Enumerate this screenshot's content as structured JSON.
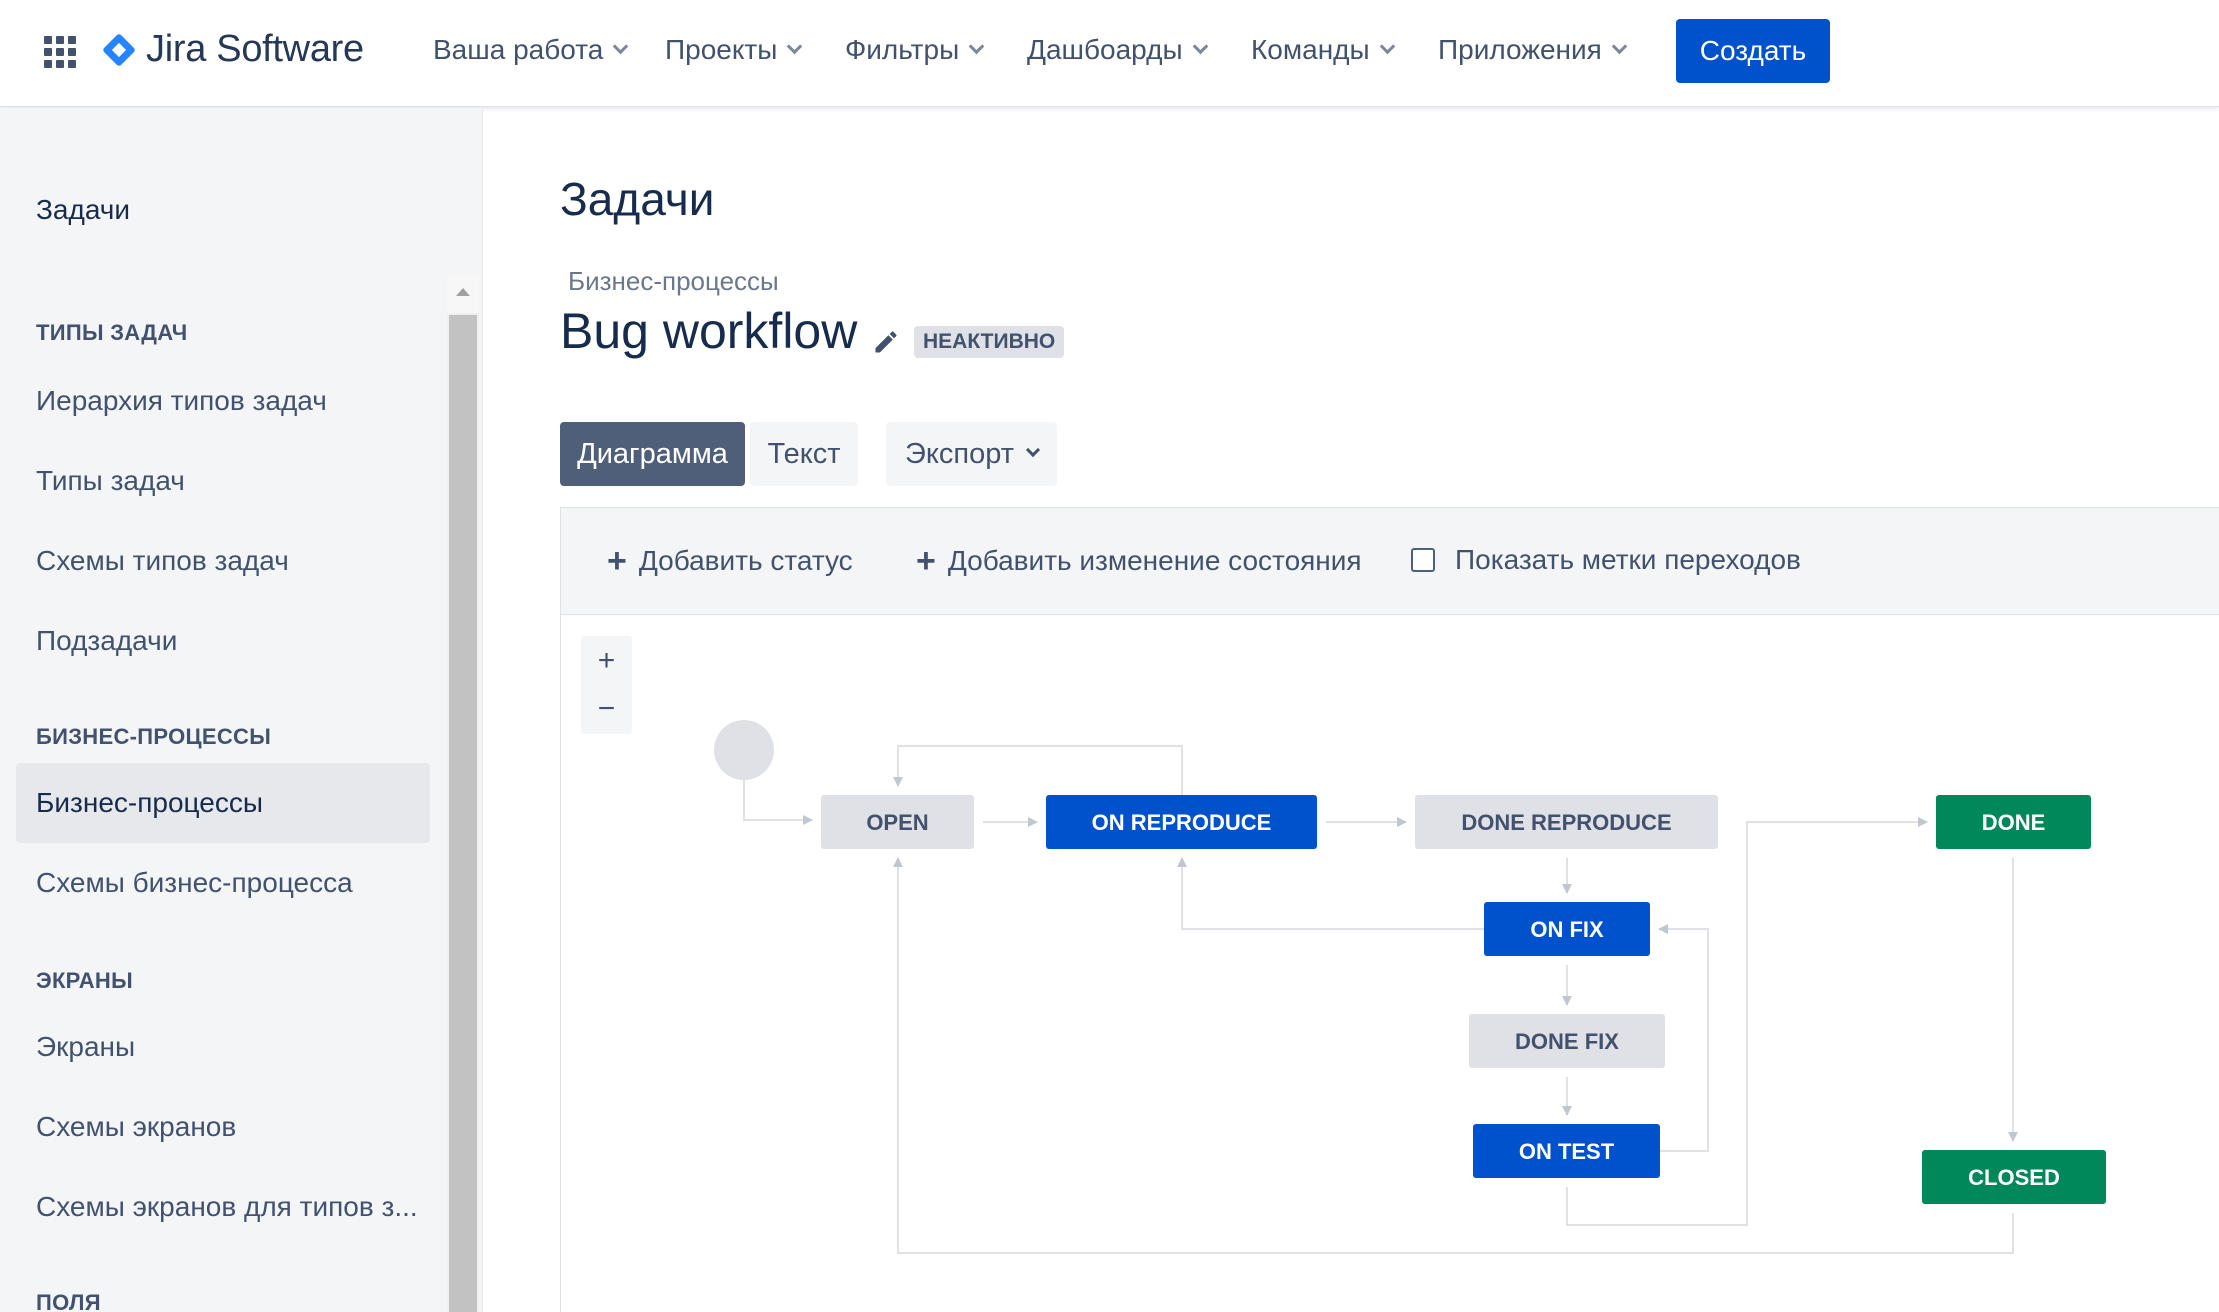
{
  "header": {
    "logo_text": "Jira Software",
    "nav": [
      "Ваша работа",
      "Проекты",
      "Фильтры",
      "Дашбоарды",
      "Команды",
      "Приложения"
    ],
    "create_label": "Создать"
  },
  "sidebar": {
    "title": "Задачи",
    "sections": [
      {
        "heading": "ТИПЫ ЗАДАЧ",
        "items": [
          "Иерархия типов задач",
          "Типы задач",
          "Схемы типов задач",
          "Подзадачи"
        ]
      },
      {
        "heading": "БИЗНЕС-ПРОЦЕССЫ",
        "items": [
          "Бизнес-процессы",
          "Схемы бизнес-процесса"
        ]
      },
      {
        "heading": "ЭКРАНЫ",
        "items": [
          "Экраны",
          "Схемы экранов",
          "Схемы экранов для типов з..."
        ]
      },
      {
        "heading": "ПОЛЯ",
        "items": []
      }
    ],
    "active_item": "Бизнес-процессы"
  },
  "main": {
    "page_title": "Задачи",
    "breadcrumb": "Бизнес-процессы",
    "workflow_name": "Bug workflow",
    "status_badge": "НЕАКТИВНО",
    "tabs": {
      "diagram": "Диаграмма",
      "text": "Текст",
      "export": "Экспорт"
    },
    "active_tab": "Диаграмма",
    "toolbar": {
      "add_status": "Добавить статус",
      "add_transition": "Добавить изменение состояния",
      "show_labels": "Показать метки переходов",
      "show_labels_checked": false
    },
    "zoom": {
      "in": "+",
      "out": "−"
    }
  },
  "diagram": {
    "statuses": [
      {
        "name": "OPEN",
        "category": "todo"
      },
      {
        "name": "ON REPRODUCE",
        "category": "in-progress"
      },
      {
        "name": "DONE REPRODUCE",
        "category": "todo"
      },
      {
        "name": "DONE",
        "category": "done"
      },
      {
        "name": "ON FIX",
        "category": "in-progress"
      },
      {
        "name": "DONE FIX",
        "category": "todo"
      },
      {
        "name": "ON TEST",
        "category": "in-progress"
      },
      {
        "name": "CLOSED",
        "category": "done"
      }
    ],
    "transitions": [
      [
        "START",
        "OPEN"
      ],
      [
        "OPEN",
        "ON REPRODUCE"
      ],
      [
        "ON REPRODUCE",
        "OPEN"
      ],
      [
        "ON REPRODUCE",
        "DONE REPRODUCE"
      ],
      [
        "DONE REPRODUCE",
        "ON FIX"
      ],
      [
        "ON FIX",
        "ON REPRODUCE"
      ],
      [
        "ON FIX",
        "DONE FIX"
      ],
      [
        "DONE FIX",
        "ON TEST"
      ],
      [
        "ON TEST",
        "ON FIX"
      ],
      [
        "ON TEST",
        "DONE"
      ],
      [
        "DONE",
        "CLOSED"
      ],
      [
        "CLOSED",
        "OPEN"
      ]
    ],
    "colors": {
      "todo_bg": "#dfe1e6",
      "todo_text": "#42526e",
      "in_progress_bg": "#0052cc",
      "in_progress_text": "#ffffff",
      "done_bg": "#00875a",
      "done_text": "#ffffff",
      "line": "#dfe1e6",
      "arrow": "#c1c7d0",
      "start": "#dfe1e6"
    }
  },
  "colors": {
    "accent": "#0052cc",
    "sidebar_bg": "#f4f5f7",
    "active_tab": "#505f79"
  }
}
